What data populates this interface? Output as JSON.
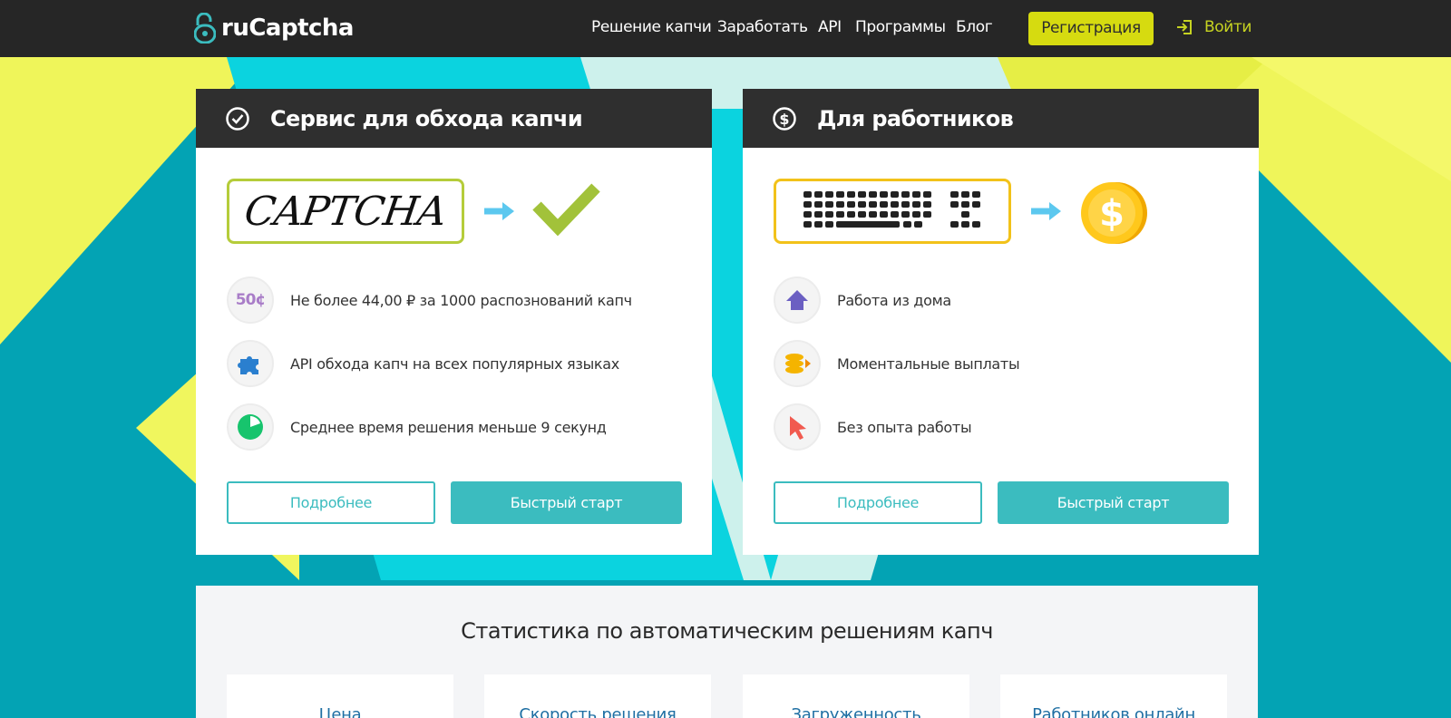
{
  "header": {
    "logo_text": "ruCaptcha",
    "nav": [
      "Решение капчи",
      "Заработать",
      "API",
      "Программы",
      "Блог"
    ],
    "register_label": "Регистрация",
    "login_label": "Войти"
  },
  "cards": [
    {
      "title": "Сервис для обхода капчи",
      "captcha_text": "CAPTCHA",
      "features": [
        {
          "icon": "price-50c-icon",
          "badge": "50¢",
          "text": "Не более 44,00 ₽ за 1000 распознований капч"
        },
        {
          "icon": "puzzle-icon",
          "text": "API обхода капч на всех популярных языках"
        },
        {
          "icon": "clock-pie-icon",
          "text": "Среднее время решения меньше 9 секунд"
        }
      ],
      "more_label": "Подробнее",
      "quick_label": "Быстрый старт"
    },
    {
      "title": "Для работников",
      "features": [
        {
          "icon": "house-icon",
          "text": "Работа из дома"
        },
        {
          "icon": "coins-icon",
          "text": "Моментальные выплаты"
        },
        {
          "icon": "cursor-icon",
          "text": "Без опыта работы"
        }
      ],
      "more_label": "Подробнее",
      "quick_label": "Быстрый старт"
    }
  ],
  "stats": {
    "title": "Статистика по автоматическим решениям капч",
    "items": [
      "Цена",
      "Скорость решения",
      "Загруженность",
      "Работников онлайн"
    ]
  },
  "colors": {
    "header_bg": "#262626",
    "accent_yellow": "#d6db10",
    "teal": "#3bbcbf",
    "card_head": "#2f2f2f",
    "bg_teal": "#03a3b4",
    "bg_cyan": "#0bd2e0",
    "bg_yellow": "#f0f652"
  }
}
